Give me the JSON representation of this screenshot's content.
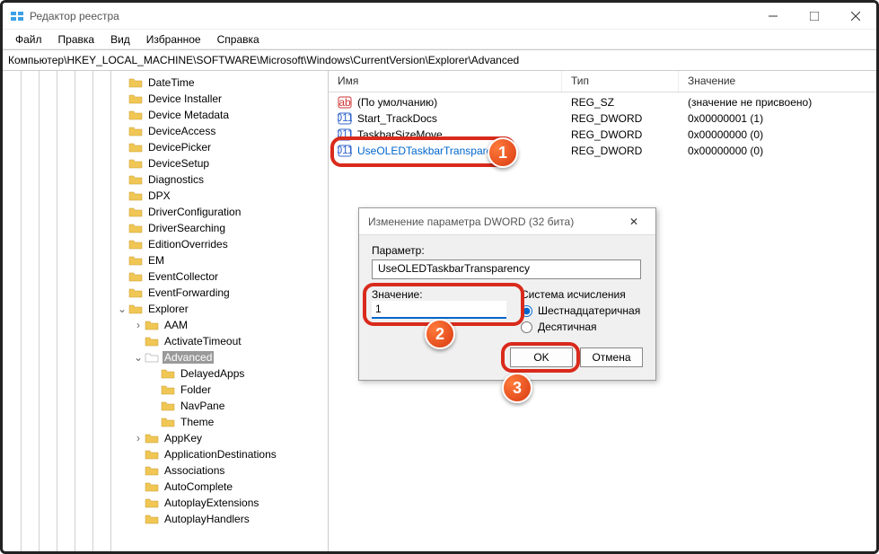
{
  "window": {
    "title": "Редактор реестра"
  },
  "menu": {
    "file": "Файл",
    "edit": "Правка",
    "view": "Вид",
    "favorites": "Избранное",
    "help": "Справка"
  },
  "address": "Компьютер\\HKEY_LOCAL_MACHINE\\SOFTWARE\\Microsoft\\Windows\\CurrentVersion\\Explorer\\Advanced",
  "tree": [
    {
      "d": 7,
      "e": "",
      "n": "DateTime"
    },
    {
      "d": 7,
      "e": "",
      "n": "Device Installer"
    },
    {
      "d": 7,
      "e": "",
      "n": "Device Metadata"
    },
    {
      "d": 7,
      "e": "",
      "n": "DeviceAccess"
    },
    {
      "d": 7,
      "e": "",
      "n": "DevicePicker"
    },
    {
      "d": 7,
      "e": "",
      "n": "DeviceSetup"
    },
    {
      "d": 7,
      "e": "",
      "n": "Diagnostics"
    },
    {
      "d": 7,
      "e": "",
      "n": "DPX"
    },
    {
      "d": 7,
      "e": "",
      "n": "DriverConfiguration"
    },
    {
      "d": 7,
      "e": "",
      "n": "DriverSearching"
    },
    {
      "d": 7,
      "e": "",
      "n": "EditionOverrides"
    },
    {
      "d": 7,
      "e": "",
      "n": "EM"
    },
    {
      "d": 7,
      "e": "",
      "n": "EventCollector"
    },
    {
      "d": 7,
      "e": "",
      "n": "EventForwarding"
    },
    {
      "d": 7,
      "e": "v",
      "n": "Explorer"
    },
    {
      "d": 8,
      "e": ">",
      "n": "AAM"
    },
    {
      "d": 8,
      "e": "",
      "n": "ActivateTimeout"
    },
    {
      "d": 8,
      "e": "v",
      "n": "Advanced",
      "sel": true
    },
    {
      "d": 9,
      "e": "",
      "n": "DelayedApps"
    },
    {
      "d": 9,
      "e": "",
      "n": "Folder"
    },
    {
      "d": 9,
      "e": "",
      "n": "NavPane"
    },
    {
      "d": 9,
      "e": "",
      "n": "Theme"
    },
    {
      "d": 8,
      "e": ">",
      "n": "AppKey"
    },
    {
      "d": 8,
      "e": "",
      "n": "ApplicationDestinations"
    },
    {
      "d": 8,
      "e": "",
      "n": "Associations"
    },
    {
      "d": 8,
      "e": "",
      "n": "AutoComplete"
    },
    {
      "d": 8,
      "e": "",
      "n": "AutoplayExtensions"
    },
    {
      "d": 8,
      "e": "",
      "n": "AutoplayHandlers"
    }
  ],
  "list": {
    "h1": "Имя",
    "h2": "Тип",
    "h3": "Значение",
    "rows": [
      {
        "t": "sz",
        "n": "(По умолчанию)",
        "ty": "REG_SZ",
        "v": "(значение не присвоено)"
      },
      {
        "t": "dw",
        "n": "Start_TrackDocs",
        "ty": "REG_DWORD",
        "v": "0x00000001 (1)"
      },
      {
        "t": "dw",
        "n": "TaskbarSizeMove",
        "ty": "REG_DWORD",
        "v": "0x00000000 (0)"
      },
      {
        "t": "dw",
        "n": "UseOLEDTaskbarTransparency",
        "ty": "REG_DWORD",
        "v": "0x00000000 (0)",
        "sel": true
      }
    ]
  },
  "dialog": {
    "title": "Изменение параметра DWORD (32 бита)",
    "param_lbl": "Параметр:",
    "param_val": "UseOLEDTaskbarTransparency",
    "value_lbl": "Значение:",
    "value": "1",
    "base_lbl": "Система исчисления",
    "hex": "Шестнадцатеричная",
    "dec": "Десятичная",
    "ok": "OK",
    "cancel": "Отмена"
  },
  "badges": {
    "b1": "1",
    "b2": "2",
    "b3": "3"
  }
}
